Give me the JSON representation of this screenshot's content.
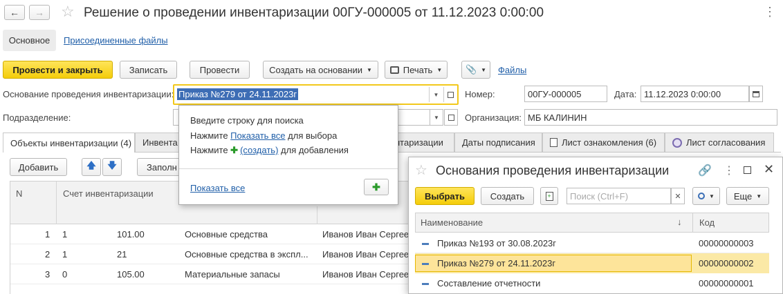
{
  "window": {
    "title": "Решение о проведении инвентаризации 00ГУ-000005 от 11.12.2023 0:00:00",
    "nav_tabs": [
      "Основное",
      "Присоединенные файлы"
    ]
  },
  "toolbar": {
    "post_close": "Провести и закрыть",
    "save": "Записать",
    "post": "Провести",
    "create_based": "Создать на основании",
    "print": "Печать",
    "files": "Файлы"
  },
  "form": {
    "basis_label": "Основание проведения инвентаризации:",
    "basis_value": "Приказ №279 от 24.11.2023г",
    "number_label": "Номер:",
    "number_value": "00ГУ-000005",
    "date_label": "Дата:",
    "date_value": "11.12.2023  0:00:00",
    "division_label": "Подразделение:",
    "org_label": "Организация:",
    "org_value": "МБ КАЛИНИН"
  },
  "tabs": {
    "objects": "Объекты инвентаризации (4)",
    "invent": "Инвента",
    "invent2": "нтаризации",
    "sign_dates": "Даты подписания",
    "ack_sheet": "Лист ознакомления (6)",
    "approval_sheet": "Лист согласования"
  },
  "table_toolbar": {
    "add": "Добавить",
    "fill": "Заполн"
  },
  "table": {
    "headers": [
      "N",
      "Счет инвентаризации"
    ],
    "rows": [
      {
        "n": "1",
        "a": "1",
        "account": "101.00",
        "name": "Основные средства",
        "person": "Иванов Иван Сергее"
      },
      {
        "n": "2",
        "a": "1",
        "account": "21",
        "name": "Основные средства в экспл...",
        "person": "Иванов Иван Сергее"
      },
      {
        "n": "3",
        "a": "0",
        "account": "105.00",
        "name": "Материальные запасы",
        "person": "Иванов Иван Сергее"
      }
    ]
  },
  "popup": {
    "line1": "Введите строку для поиска",
    "line2_pre": "Нажмите ",
    "line2_link": "Показать все",
    "line2_post": " для выбора",
    "line3_pre": "Нажмите ",
    "line3_link": "(создать)",
    "line3_post": " для добавления",
    "show_all": "Показать все"
  },
  "panel": {
    "title": "Основания проведения инвентаризации",
    "select": "Выбрать",
    "create": "Создать",
    "search_placeholder": "Поиск (Ctrl+F)",
    "more": "Еще",
    "col_name": "Наименование",
    "col_code": "Код",
    "rows": [
      {
        "name": "Приказ №193 от 30.08.2023г",
        "code": "00000000003"
      },
      {
        "name": "Приказ №279 от 24.11.2023г",
        "code": "00000000002"
      },
      {
        "name": "Составление отчетности",
        "code": "00000000001"
      }
    ]
  },
  "colors": {
    "accent_yellow": "#f4cd0a",
    "selected_row": "#fbe9a6",
    "link": "#1f5ea8",
    "selection_blue": "#3d6db5"
  }
}
